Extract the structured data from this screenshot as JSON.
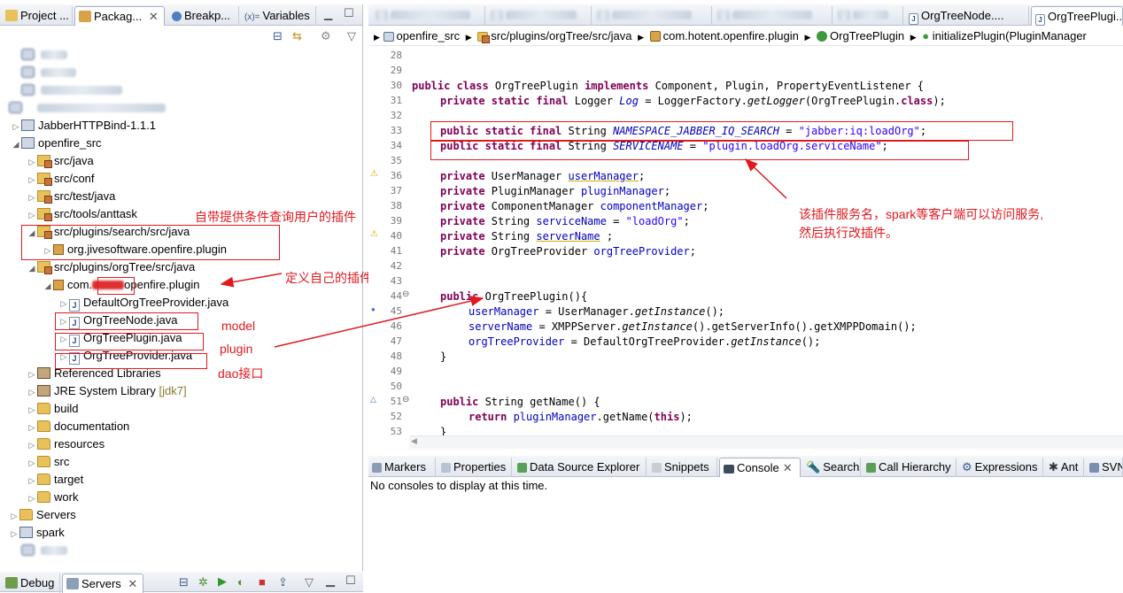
{
  "left_tabs": [
    "Project ...",
    "Packag...",
    "Breakp...",
    "Variables"
  ],
  "left_tab_prefix_var": "(x)=",
  "editor_tabs": [
    "OrgTreeNode....",
    "OrgTreePlugi..."
  ],
  "breadcrumb": [
    "openfire_src",
    "src/plugins/orgTree/src/java",
    "com.hotent.openfire.plugin",
    "OrgTreePlugin",
    "initializePlugin(PluginManager"
  ],
  "tree": {
    "jabber": "JabberHTTPBind-1.1.1",
    "openfire_src": "openfire_src",
    "src_java": "src/java",
    "src_conf": "src/conf",
    "src_test": "src/test/java",
    "src_tools": "src/tools/anttask",
    "search_plugin": "src/plugins/search/src/java",
    "search_pkg": "org.jivesoftware.openfire.plugin",
    "orgtree_src": "src/plugins/orgTree/src/java",
    "orgtree_pkg_a": "com.",
    "orgtree_pkg_b": "openfire.plugin",
    "file_default": "DefaultOrgTreeProvider.java",
    "file_node": "OrgTreeNode.java",
    "file_plugin": "OrgTreePlugin.java",
    "file_provider": "OrgTreeProvider.java",
    "ref_libs": "Referenced Libraries",
    "jre": "JRE System Library",
    "jre_tag": "[jdk7]",
    "build": "build",
    "documentation": "documentation",
    "resources": "resources",
    "src": "src",
    "target": "target",
    "work": "work",
    "servers": "Servers",
    "spark": "spark"
  },
  "annotations": {
    "search": "自带提供条件查询用户的插件",
    "pkg": "定义自己的插件包",
    "model": "model",
    "plugin": "plugin",
    "dao": "dao接口",
    "service": "该插件服务名，spark等客户端可以访问服务,",
    "service2": "然后执行改插件。"
  },
  "code_lines": [
    {
      "n": "28"
    },
    {
      "n": "29"
    },
    {
      "n": "30"
    },
    {
      "n": "31"
    },
    {
      "n": "32"
    },
    {
      "n": "33"
    },
    {
      "n": "34"
    },
    {
      "n": "35"
    },
    {
      "n": "36"
    },
    {
      "n": "37"
    },
    {
      "n": "38"
    },
    {
      "n": "39"
    },
    {
      "n": "40"
    },
    {
      "n": "41"
    },
    {
      "n": "42"
    },
    {
      "n": "43"
    },
    {
      "n": "44"
    },
    {
      "n": "45"
    },
    {
      "n": "46"
    },
    {
      "n": "47"
    },
    {
      "n": "48"
    },
    {
      "n": "49"
    },
    {
      "n": "50"
    },
    {
      "n": "51"
    },
    {
      "n": "52"
    },
    {
      "n": "53"
    }
  ],
  "code": {
    "l30": [
      "public class ",
      "OrgTreePlugin ",
      "implements ",
      "Component, Plugin, PropertyEventListener {"
    ],
    "l31": [
      "private static final ",
      "Logger ",
      "Log",
      " = LoggerFactory.",
      "getLogger",
      "(OrgTreePlugin.",
      "class",
      ");"
    ],
    "l33": [
      "public static final ",
      "String ",
      "NAMESPACE_JABBER_IQ_SEARCH",
      " = ",
      "\"jabber:iq:loadOrg\"",
      ";"
    ],
    "l34": [
      "public static final ",
      "String ",
      "SERVICENAME",
      " = ",
      "\"plugin.loadOrg.serviceName\"",
      ";"
    ],
    "l36": [
      "private ",
      "UserManager ",
      "userManager",
      ";"
    ],
    "l37": [
      "private ",
      "PluginManager ",
      "pluginManager",
      ";"
    ],
    "l38": [
      "private ",
      "ComponentManager ",
      "componentManager",
      ";"
    ],
    "l39": [
      "private ",
      "String ",
      "serviceName",
      " = ",
      "\"loadOrg\"",
      ";"
    ],
    "l40": [
      "private ",
      "String ",
      "serverName",
      " ;"
    ],
    "l41": [
      "private ",
      "OrgTreeProvider ",
      "orgTreeProvider",
      ";"
    ],
    "l44": [
      "public ",
      "OrgTreePlugin(){"
    ],
    "l45": [
      "userManager",
      " = UserManager.",
      "getInstance",
      "();"
    ],
    "l46": [
      "serverName",
      " = XMPPServer.",
      "getInstance",
      "().getServerInfo().getXMPPDomain();"
    ],
    "l47": [
      "orgTreeProvider",
      " = DefaultOrgTreeProvider.",
      "getInstance",
      "();"
    ],
    "l48": [
      "}"
    ],
    "l51": [
      "public ",
      "String getName() {"
    ],
    "l52": [
      "return ",
      "pluginManager",
      ".getName(",
      "this",
      ");"
    ],
    "l53": [
      "}"
    ]
  },
  "bottom_tabs": [
    "Markers",
    "Properties",
    "Data Source Explorer",
    "Snippets",
    "Console",
    "Search",
    "Call Hierarchy",
    "Expressions",
    "Ant",
    "SVN"
  ],
  "console_message": "No consoles to display at this time.",
  "lower_left_tabs": [
    "Debug",
    "Servers"
  ]
}
